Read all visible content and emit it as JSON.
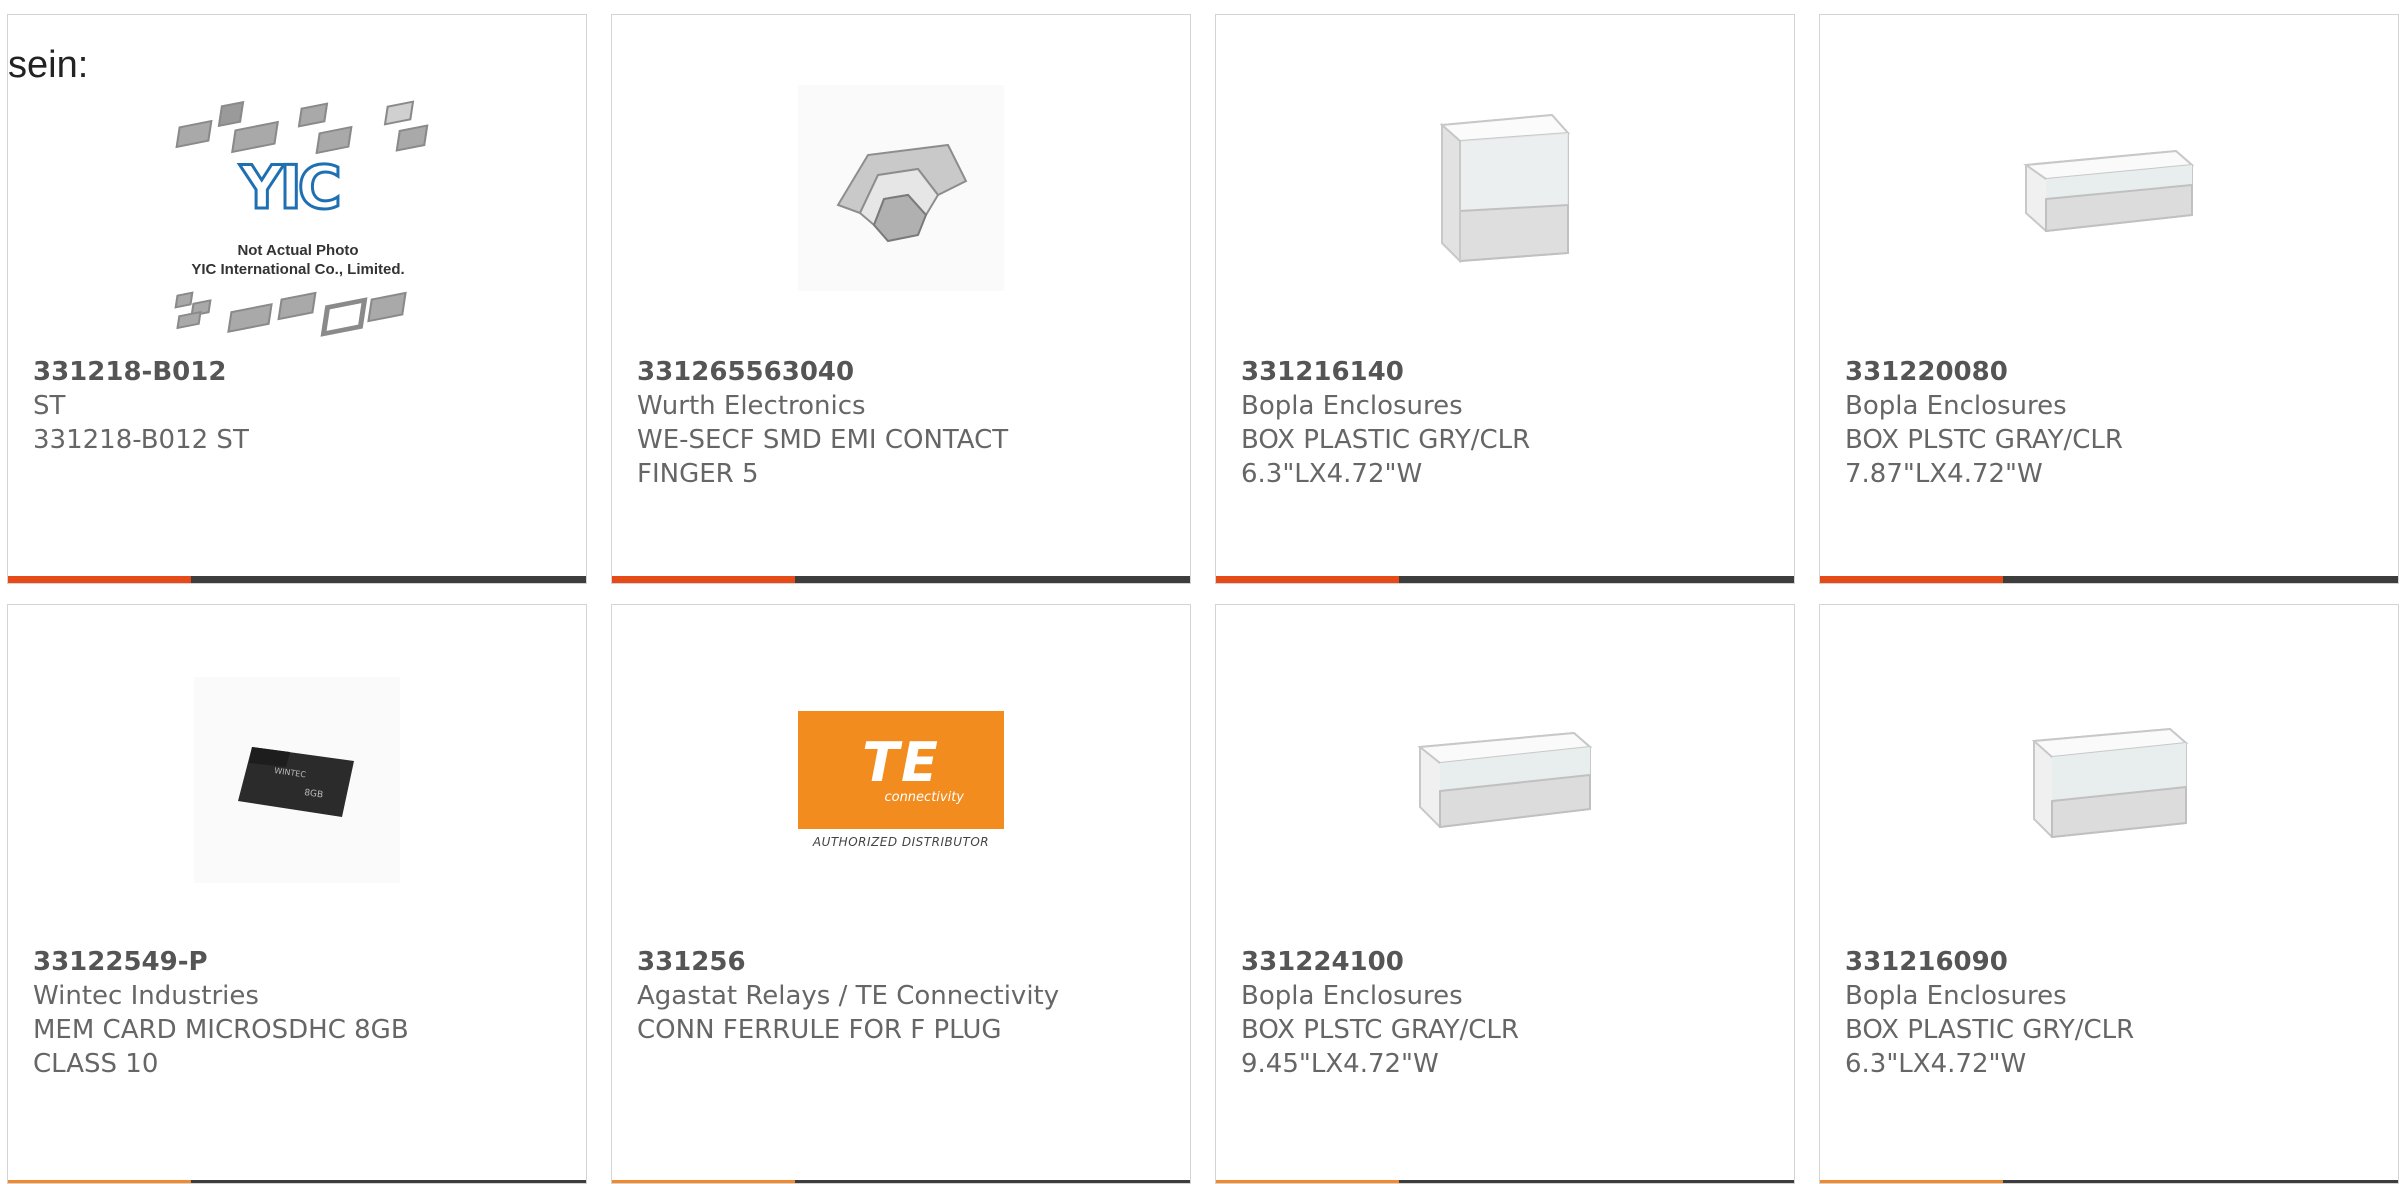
{
  "intro_text": "sein:",
  "products": [
    {
      "part": "331218-B012",
      "manufacturer": "ST",
      "description": "331218-B012 ST",
      "image": "yic-placeholder"
    },
    {
      "part": "331265563040",
      "manufacturer": "Wurth Electronics",
      "description": "WE-SECF SMD EMI CONTACT\nFINGER 5",
      "image": "contact-finger"
    },
    {
      "part": "331216140",
      "manufacturer": "Bopla Enclosures",
      "description": "BOX PLASTIC GRY/CLR\n6.3\"LX4.72\"W",
      "image": "enclosure-tall"
    },
    {
      "part": "331220080",
      "manufacturer": "Bopla Enclosures",
      "description": "BOX PLSTC GRAY/CLR\n7.87\"LX4.72\"W",
      "image": "enclosure-flat"
    },
    {
      "part": "33122549-P",
      "manufacturer": "Wintec Industries",
      "description": "MEM CARD MICROSDHC 8GB\nCLASS 10",
      "image": "microsd-card"
    },
    {
      "part": "331256",
      "manufacturer": "Agastat Relays / TE Connectivity",
      "description": "CONN FERRULE FOR F PLUG",
      "image": "te-logo"
    },
    {
      "part": "331224100",
      "manufacturer": "Bopla Enclosures",
      "description": "BOX PLSTC GRAY/CLR\n9.45\"LX4.72\"W",
      "image": "enclosure-flat"
    },
    {
      "part": "331216090",
      "manufacturer": "Bopla Enclosures",
      "description": "BOX PLASTIC GRY/CLR\n6.3\"LX4.72\"W",
      "image": "enclosure-medium"
    }
  ],
  "yic": {
    "logo": "YIC",
    "caption_line1": "Not Actual Photo",
    "caption_line2": "YIC International Co., Limited."
  },
  "te": {
    "logo": "TE",
    "sub": "connectivity",
    "authorized": "AUTHORIZED DISTRIBUTOR"
  },
  "colors": {
    "accent": "#e64a19",
    "bar": "#3d3d3d",
    "te_orange": "#f28c1e",
    "yic_blue": "#1f6fb3"
  }
}
